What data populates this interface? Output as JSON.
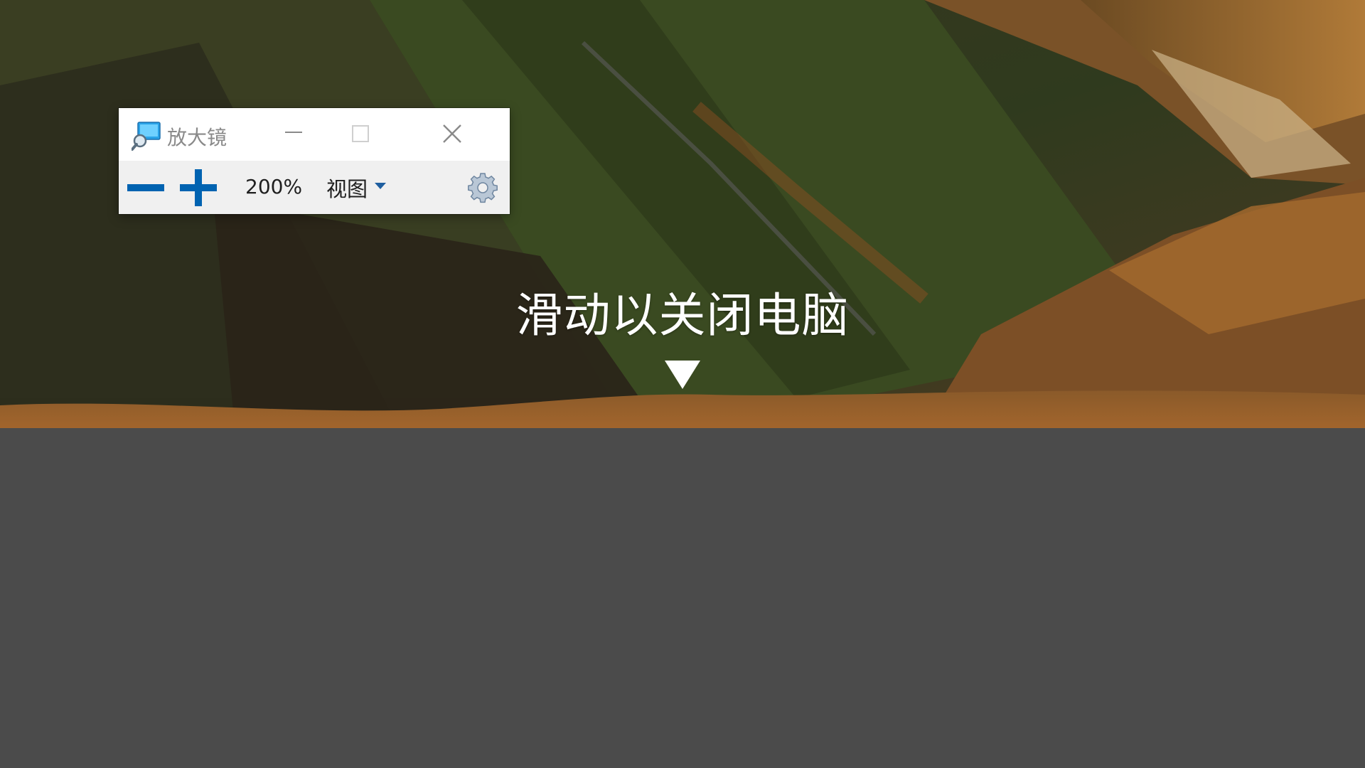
{
  "screen": {
    "background_color": "#4b4b4b",
    "shutdown_prompt": "滑动以关闭电脑",
    "arrow_icon": "down-triangle-icon"
  },
  "magnifier": {
    "title": "放大镜",
    "app_icon": "magnifier-app-icon",
    "window_controls": {
      "minimize_icon": "minimize-icon",
      "maximize_icon": "maximize-icon",
      "close_icon": "close-icon"
    },
    "toolbar": {
      "zoom_out_icon": "minus-icon",
      "zoom_in_icon": "plus-icon",
      "zoom_level": "200%",
      "view_label": "视图",
      "view_caret_icon": "caret-down-icon",
      "settings_icon": "gear-icon"
    },
    "accent_color": "#0063b1"
  }
}
